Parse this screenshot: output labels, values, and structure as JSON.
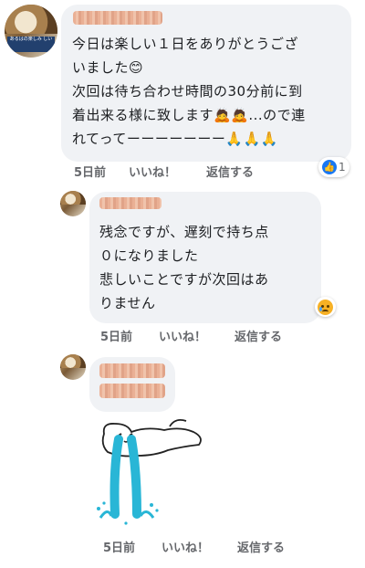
{
  "comments": [
    {
      "lines": [
        "今日は楽しい１日をありがとうござ",
        "いました😊",
        "次回は待ち合わせ時間の30分前に到",
        "着出来る様に致します🙇🙇...ので連",
        "れてってーーーーーーー🙏🙏🙏"
      ],
      "time": "5日前",
      "like": "いいね！",
      "reply": "返信する",
      "reaction_count": "1",
      "reaction_icon": "like-icon"
    },
    {
      "lines": [
        "残念ですが、遅刻で持ち点",
        "０になりました",
        "悲しいことですが次回はあ",
        "りません"
      ],
      "time": "5日前",
      "like": "いいね！",
      "reply": "返信する",
      "reaction_icon": "sad-face-icon"
    },
    {
      "time": "5日前",
      "like": "いいね！",
      "reply": "返信する",
      "sticker": "crying-rabbit-sticker"
    }
  ],
  "avatar_text": "あるはの楽しみ\nしい",
  "colors": {
    "bubble": "#f0f2f5",
    "meta": "#65676b",
    "like_blue": "#1877f2",
    "tears": "#29b6d6"
  }
}
